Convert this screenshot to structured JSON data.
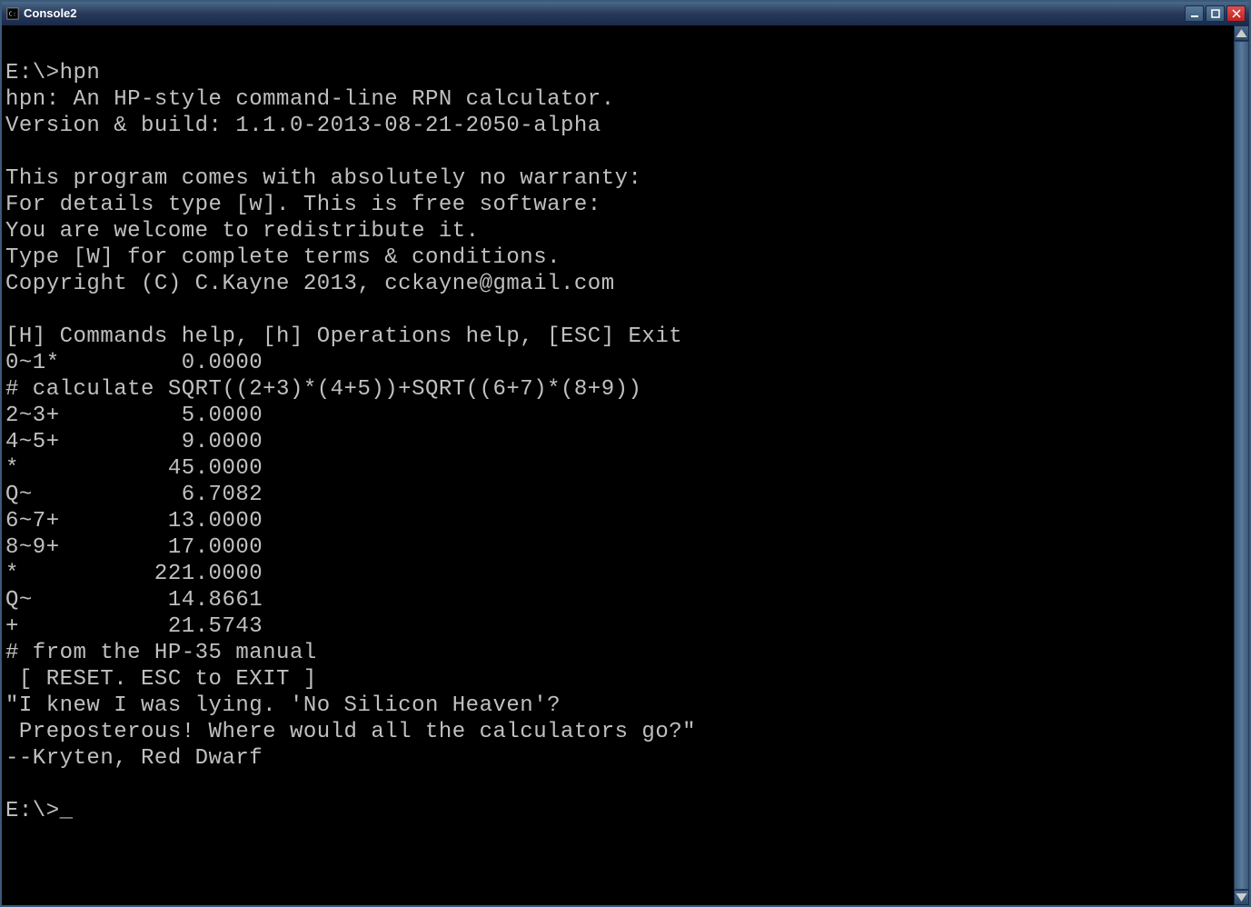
{
  "window": {
    "title": "Console2"
  },
  "terminal": {
    "lines": [
      "E:\\>hpn",
      "hpn: An HP-style command-line RPN calculator.",
      "Version & build: 1.1.0-2013-08-21-2050-alpha",
      "",
      "This program comes with absolutely no warranty:",
      "For details type [w]. This is free software:",
      "You are welcome to redistribute it.",
      "Type [W] for complete terms & conditions.",
      "Copyright (C) C.Kayne 2013, cckayne@gmail.com",
      "",
      "[H] Commands help, [h] Operations help, [ESC] Exit",
      "0~1*         0.0000",
      "# calculate SQRT((2+3)*(4+5))+SQRT((6+7)*(8+9))",
      "2~3+         5.0000",
      "4~5+         9.0000",
      "*           45.0000",
      "Q~           6.7082",
      "6~7+        13.0000",
      "8~9+        17.0000",
      "*          221.0000",
      "Q~          14.8661",
      "+           21.5743",
      "# from the HP-35 manual",
      " [ RESET. ESC to EXIT ]",
      "\"I knew I was lying. 'No Silicon Heaven'?",
      " Preposterous! Where would all the calculators go?\"",
      "--Kryten, Red Dwarf",
      "",
      "E:\\>"
    ],
    "cursor": "_"
  }
}
